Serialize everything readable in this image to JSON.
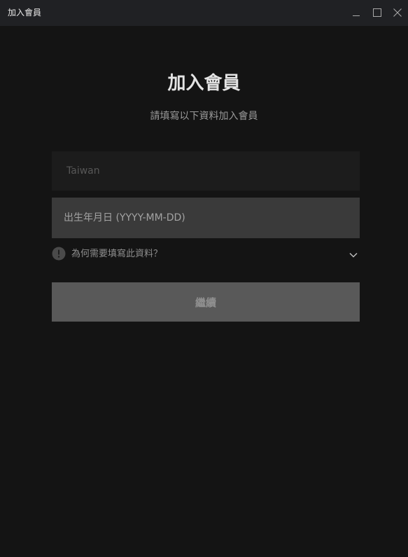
{
  "window": {
    "title": "加入會員",
    "controls": {
      "minimize_icon": "minimize-icon",
      "maximize_icon": "maximize-icon",
      "close_icon": "close-icon"
    }
  },
  "main": {
    "heading": "加入會員",
    "subheading": "請填寫以下資料加入會員",
    "country_field": {
      "value": "Taiwan"
    },
    "birthdate_field": {
      "value": "",
      "placeholder": "出生年月日 (YYYY-MM-DD)"
    },
    "why_info": {
      "label": "為何需要填寫此資料？",
      "icon": "info-icon",
      "toggle_icon": "chevron-down-icon"
    },
    "continue_button": {
      "label": "繼續"
    }
  },
  "colors": {
    "background": "#141414",
    "titlebar": "#202124",
    "input_disabled": "#1c1c1c",
    "input_active": "#3a3a3a",
    "button_disabled": "#595959"
  }
}
